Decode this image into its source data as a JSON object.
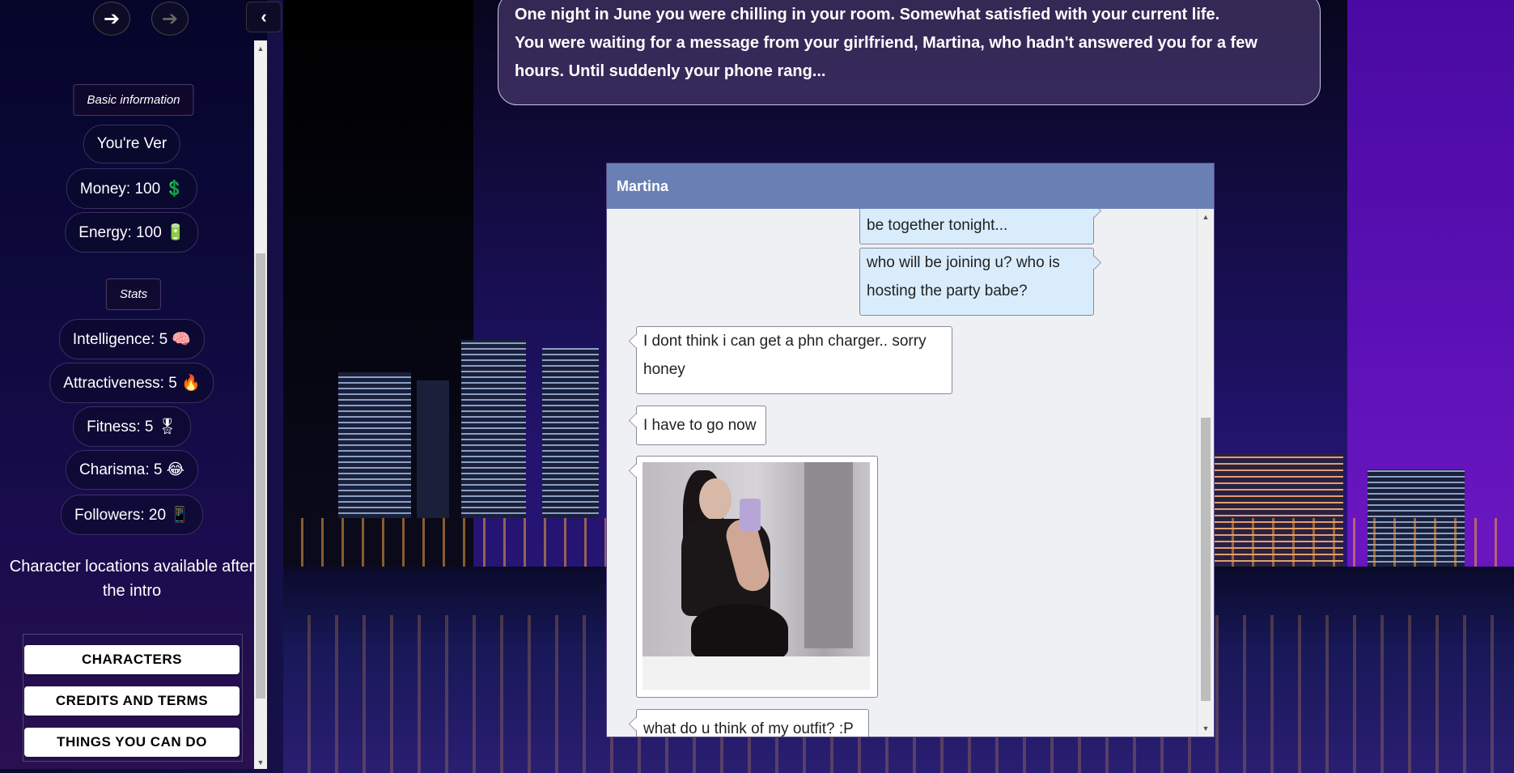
{
  "nav": {
    "back_icon": "arrow-left-icon",
    "forward_icon": "arrow-right-icon",
    "collapse_icon": "chevron-left-icon"
  },
  "sidebar": {
    "basic_info_title": "Basic information",
    "name": "You're Ver",
    "money": "Money: 100 💲",
    "energy": "Energy: 100 🔋",
    "stats_title": "Stats",
    "stats": [
      "Intelligence: 5 🧠",
      "Attractiveness: 5 🔥",
      "Fitness: 5 🎖",
      "Charisma: 5 😂",
      "Followers: 20 📱"
    ],
    "locations_note": "Character locations available after the intro",
    "menu": [
      "CHARACTERS",
      "CREDITS AND TERMS",
      "THINGS YOU CAN DO"
    ]
  },
  "narrative": {
    "line1": "One night in June you were chilling in your room. Somewhat satisfied with your current life.",
    "line2": "You were waiting for a message from your girlfriend, Martina, who hadn't answered you for a few hours. Until suddenly your phone rang..."
  },
  "chat": {
    "contact_name": "Martina",
    "messages": [
      {
        "type": "out",
        "text": "be together tonight..."
      },
      {
        "type": "out",
        "text": "who will be joining u? who is hosting the party babe?"
      },
      {
        "type": "in",
        "text": "I dont think i can get a phn charger.. sorry honey"
      },
      {
        "type": "in",
        "text": "I have to go now"
      },
      {
        "type": "in",
        "text": "what do u think of my outfit? :P"
      }
    ]
  },
  "colors": {
    "chat_header": "#6a80b4",
    "outgoing_bubble": "#d9ecfc",
    "incoming_bubble": "#ffffff"
  }
}
